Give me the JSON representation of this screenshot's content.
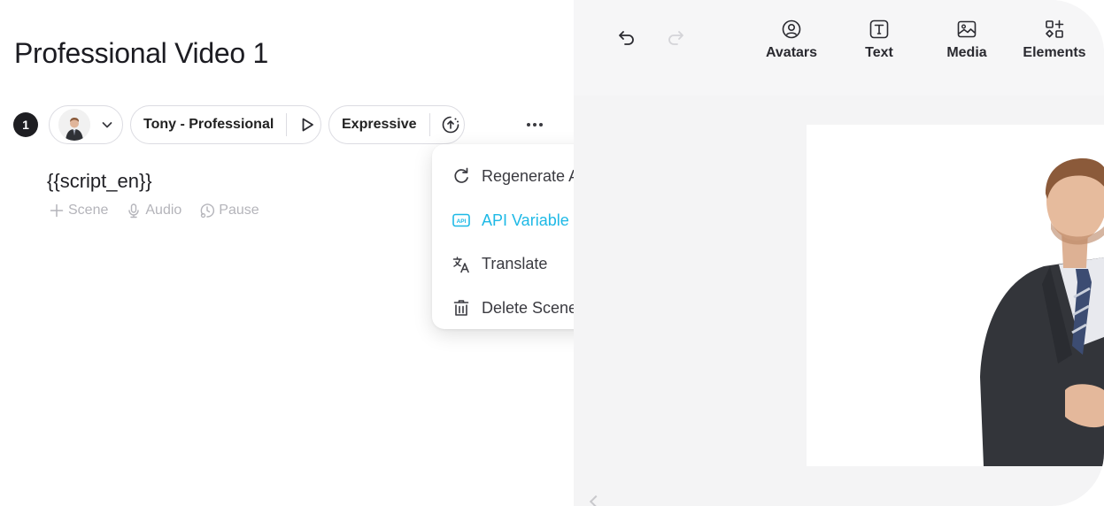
{
  "project": {
    "title": "Professional Video 1"
  },
  "scene": {
    "number": "1",
    "avatar_icon": "avatar-thumbnail",
    "voice_name": "Tony - Professional",
    "voice_style": "Expressive",
    "script": "{{script_en}}",
    "actions": [
      {
        "label": "Scene",
        "icon": "plus-icon"
      },
      {
        "label": "Audio",
        "icon": "microphone-icon"
      },
      {
        "label": "Pause",
        "icon": "pause-clock-icon"
      }
    ]
  },
  "context_menu": {
    "items": [
      {
        "label": "Regenerate Audio",
        "icon": "regenerate-icon",
        "active": false
      },
      {
        "label": "API Variable",
        "icon": "api-icon",
        "active": true
      },
      {
        "label": "Translate",
        "icon": "translate-icon",
        "active": false
      },
      {
        "label": "Delete Scene",
        "icon": "trash-icon",
        "active": false
      }
    ]
  },
  "toolbar": {
    "undo_icon": "undo-icon",
    "redo_icon": "redo-icon",
    "tools": [
      {
        "label": "Avatars",
        "icon": "avatar-circle-icon"
      },
      {
        "label": "Text",
        "icon": "text-box-icon"
      },
      {
        "label": "Media",
        "icon": "image-icon"
      },
      {
        "label": "Elements",
        "icon": "shapes-icon"
      }
    ]
  },
  "colors": {
    "accent": "#1eb9e6",
    "canvas_bg": "#f4f4f5",
    "muted_text": "#b4b4ba"
  }
}
